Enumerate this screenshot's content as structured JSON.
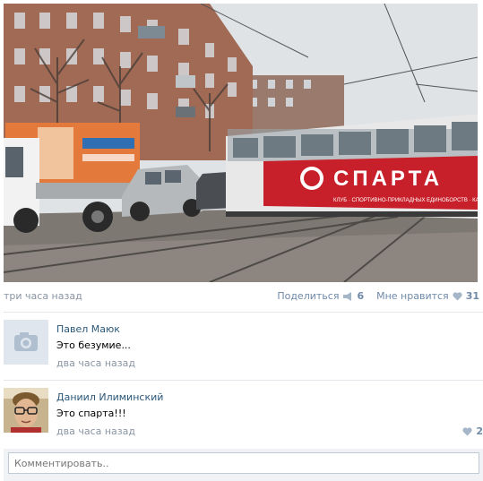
{
  "post": {
    "time": "три часа назад",
    "share_label": "Поделиться",
    "share_count": "6",
    "like_label": "Мне нравится",
    "like_count": "31",
    "photo_sign_text": "СПАРТА",
    "photo_tram_subtext": "КЛУБ СПОРТИВНО-ПРИКЛАДНЫХ ЕДИНОБОРСТВ · КАРАТЭ · КУДО · ММА"
  },
  "comments": [
    {
      "author": "Павел Маюк",
      "text": "Это безумие...",
      "time": "два часа назад",
      "likes": "",
      "avatar": "camera-placeholder"
    },
    {
      "author": "Даниил Илиминский",
      "text": "Это спарта!!!",
      "time": "два часа назад",
      "likes": "2",
      "avatar": "user-photo"
    }
  ],
  "reply": {
    "placeholder": "Комментировать.."
  },
  "colors": {
    "link": "#2b587a",
    "muted": "#8a95a3",
    "action": "#6f89a8",
    "tram_red": "#c8202a"
  }
}
